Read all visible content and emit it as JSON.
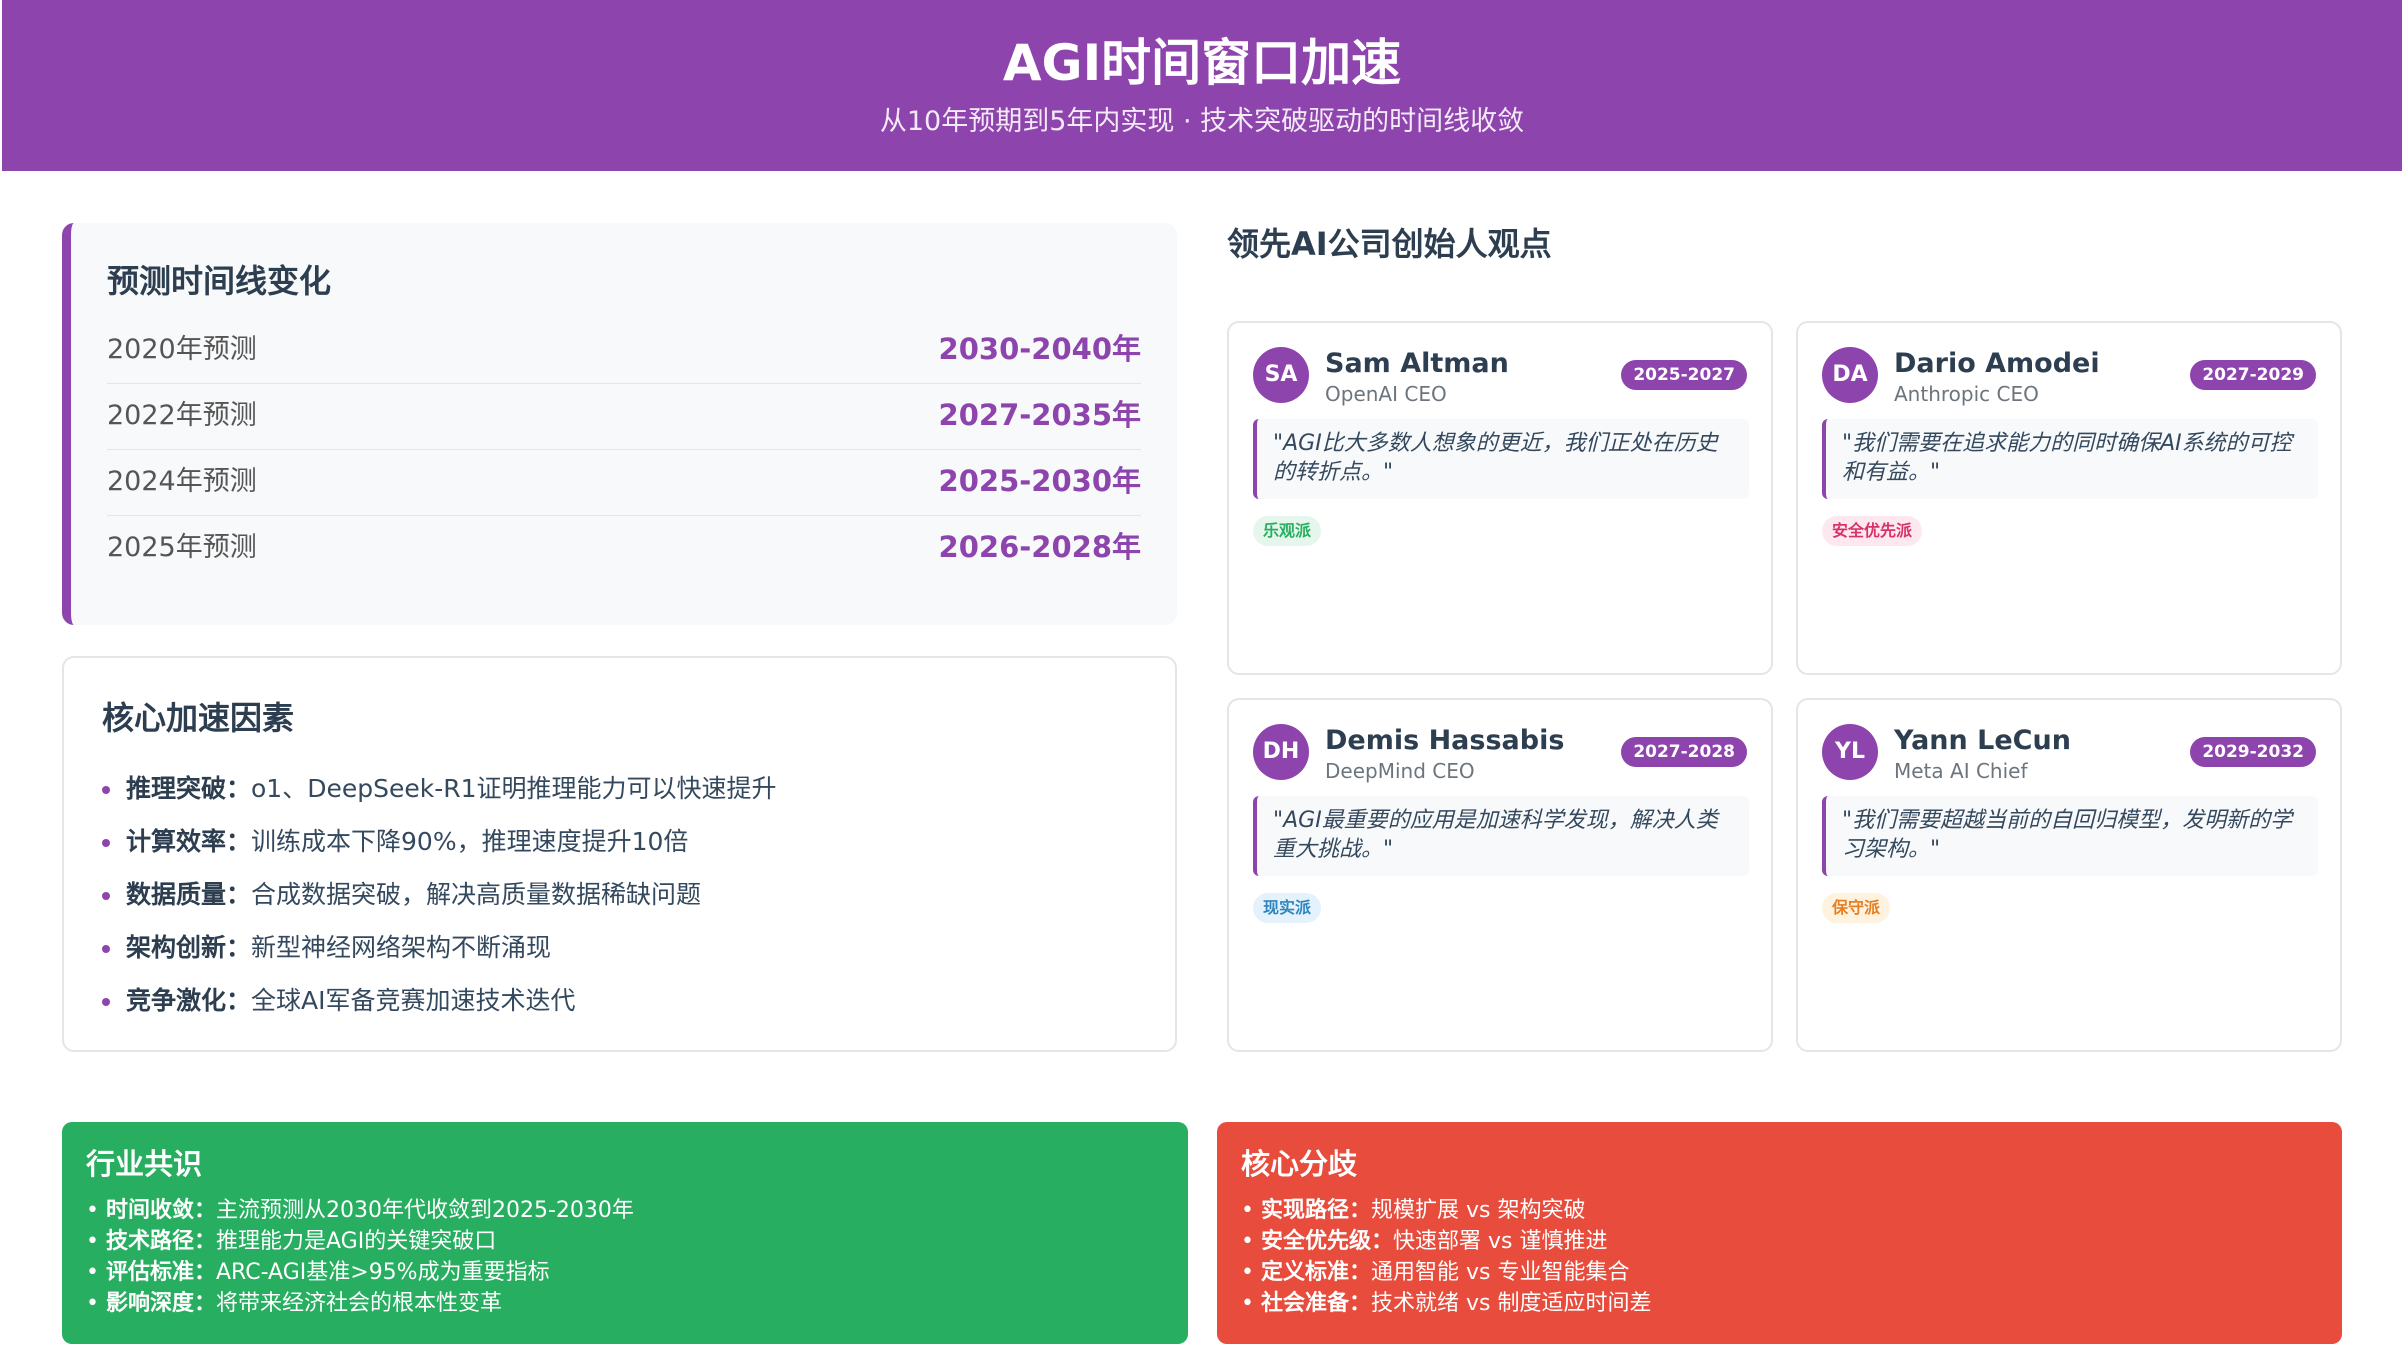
{
  "header": {
    "title": "AGI时间窗口加速",
    "subtitle": "从10年预期到5年内实现 · 技术突破驱动的时间线收敛"
  },
  "timeline": {
    "title": "预测时间线变化",
    "rows": [
      {
        "label": "2020年预测",
        "value": "2030-2040年"
      },
      {
        "label": "2022年预测",
        "value": "2027-2035年"
      },
      {
        "label": "2024年预测",
        "value": "2025-2030年"
      },
      {
        "label": "2025年预测",
        "value": "2026-2028年"
      }
    ]
  },
  "factors": {
    "title": "核心加速因素",
    "items": [
      {
        "key": "推理突破：",
        "text": "o1、DeepSeek-R1证明推理能力可以快速提升"
      },
      {
        "key": "计算效率：",
        "text": "训练成本下降90%，推理速度提升10倍"
      },
      {
        "key": "数据质量：",
        "text": "合成数据突破，解决高质量数据稀缺问题"
      },
      {
        "key": "架构创新：",
        "text": "新型神经网络架构不断涌现"
      },
      {
        "key": "竞争激化：",
        "text": "全球AI军备竞赛加速技术迭代"
      }
    ]
  },
  "leaders": {
    "title": "领先AI公司创始人观点",
    "cards": [
      {
        "initials": "SA",
        "name": "Sam Altman",
        "role": "OpenAI CEO",
        "years": "2025-2027",
        "quote": "\"AGI比大多数人想象的更近，我们正处在历史的转折点。\"",
        "tag": "乐观派"
      },
      {
        "initials": "DA",
        "name": "Dario Amodei",
        "role": "Anthropic CEO",
        "years": "2027-2029",
        "quote": "\"我们需要在追求能力的同时确保AI系统的可控和有益。\"",
        "tag": "安全优先派"
      },
      {
        "initials": "DH",
        "name": "Demis Hassabis",
        "role": "DeepMind CEO",
        "years": "2027-2028",
        "quote": "\"AGI最重要的应用是加速科学发现，解决人类重大挑战。\"",
        "tag": "现实派"
      },
      {
        "initials": "YL",
        "name": "Yann LeCun",
        "role": "Meta AI Chief",
        "years": "2029-2032",
        "quote": "\"我们需要超越当前的自回归模型，发明新的学习架构。\"",
        "tag": "保守派"
      }
    ]
  },
  "consensus": {
    "title": "行业共识",
    "items": [
      {
        "key": "时间收敛：",
        "text": "主流预测从2030年代收敛到2025-2030年"
      },
      {
        "key": "技术路径：",
        "text": "推理能力是AGI的关键突破口"
      },
      {
        "key": "评估标准：",
        "text": "ARC-AGI基准>95%成为重要指标"
      },
      {
        "key": "影响深度：",
        "text": "将带来经济社会的根本性变革"
      }
    ]
  },
  "divergence": {
    "title": "核心分歧",
    "items": [
      {
        "key": "实现路径：",
        "text": "规模扩展 vs 架构突破"
      },
      {
        "key": "安全优先级：",
        "text": "快速部署 vs 谨慎推进"
      },
      {
        "key": "定义标准：",
        "text": "通用智能 vs 专业智能集合"
      },
      {
        "key": "社会准备：",
        "text": "技术就绪 vs 制度适应时间差"
      }
    ]
  },
  "colors": {
    "accent": "#8e44ad",
    "consensus": "#27ae60",
    "divergence": "#e74c3c"
  }
}
